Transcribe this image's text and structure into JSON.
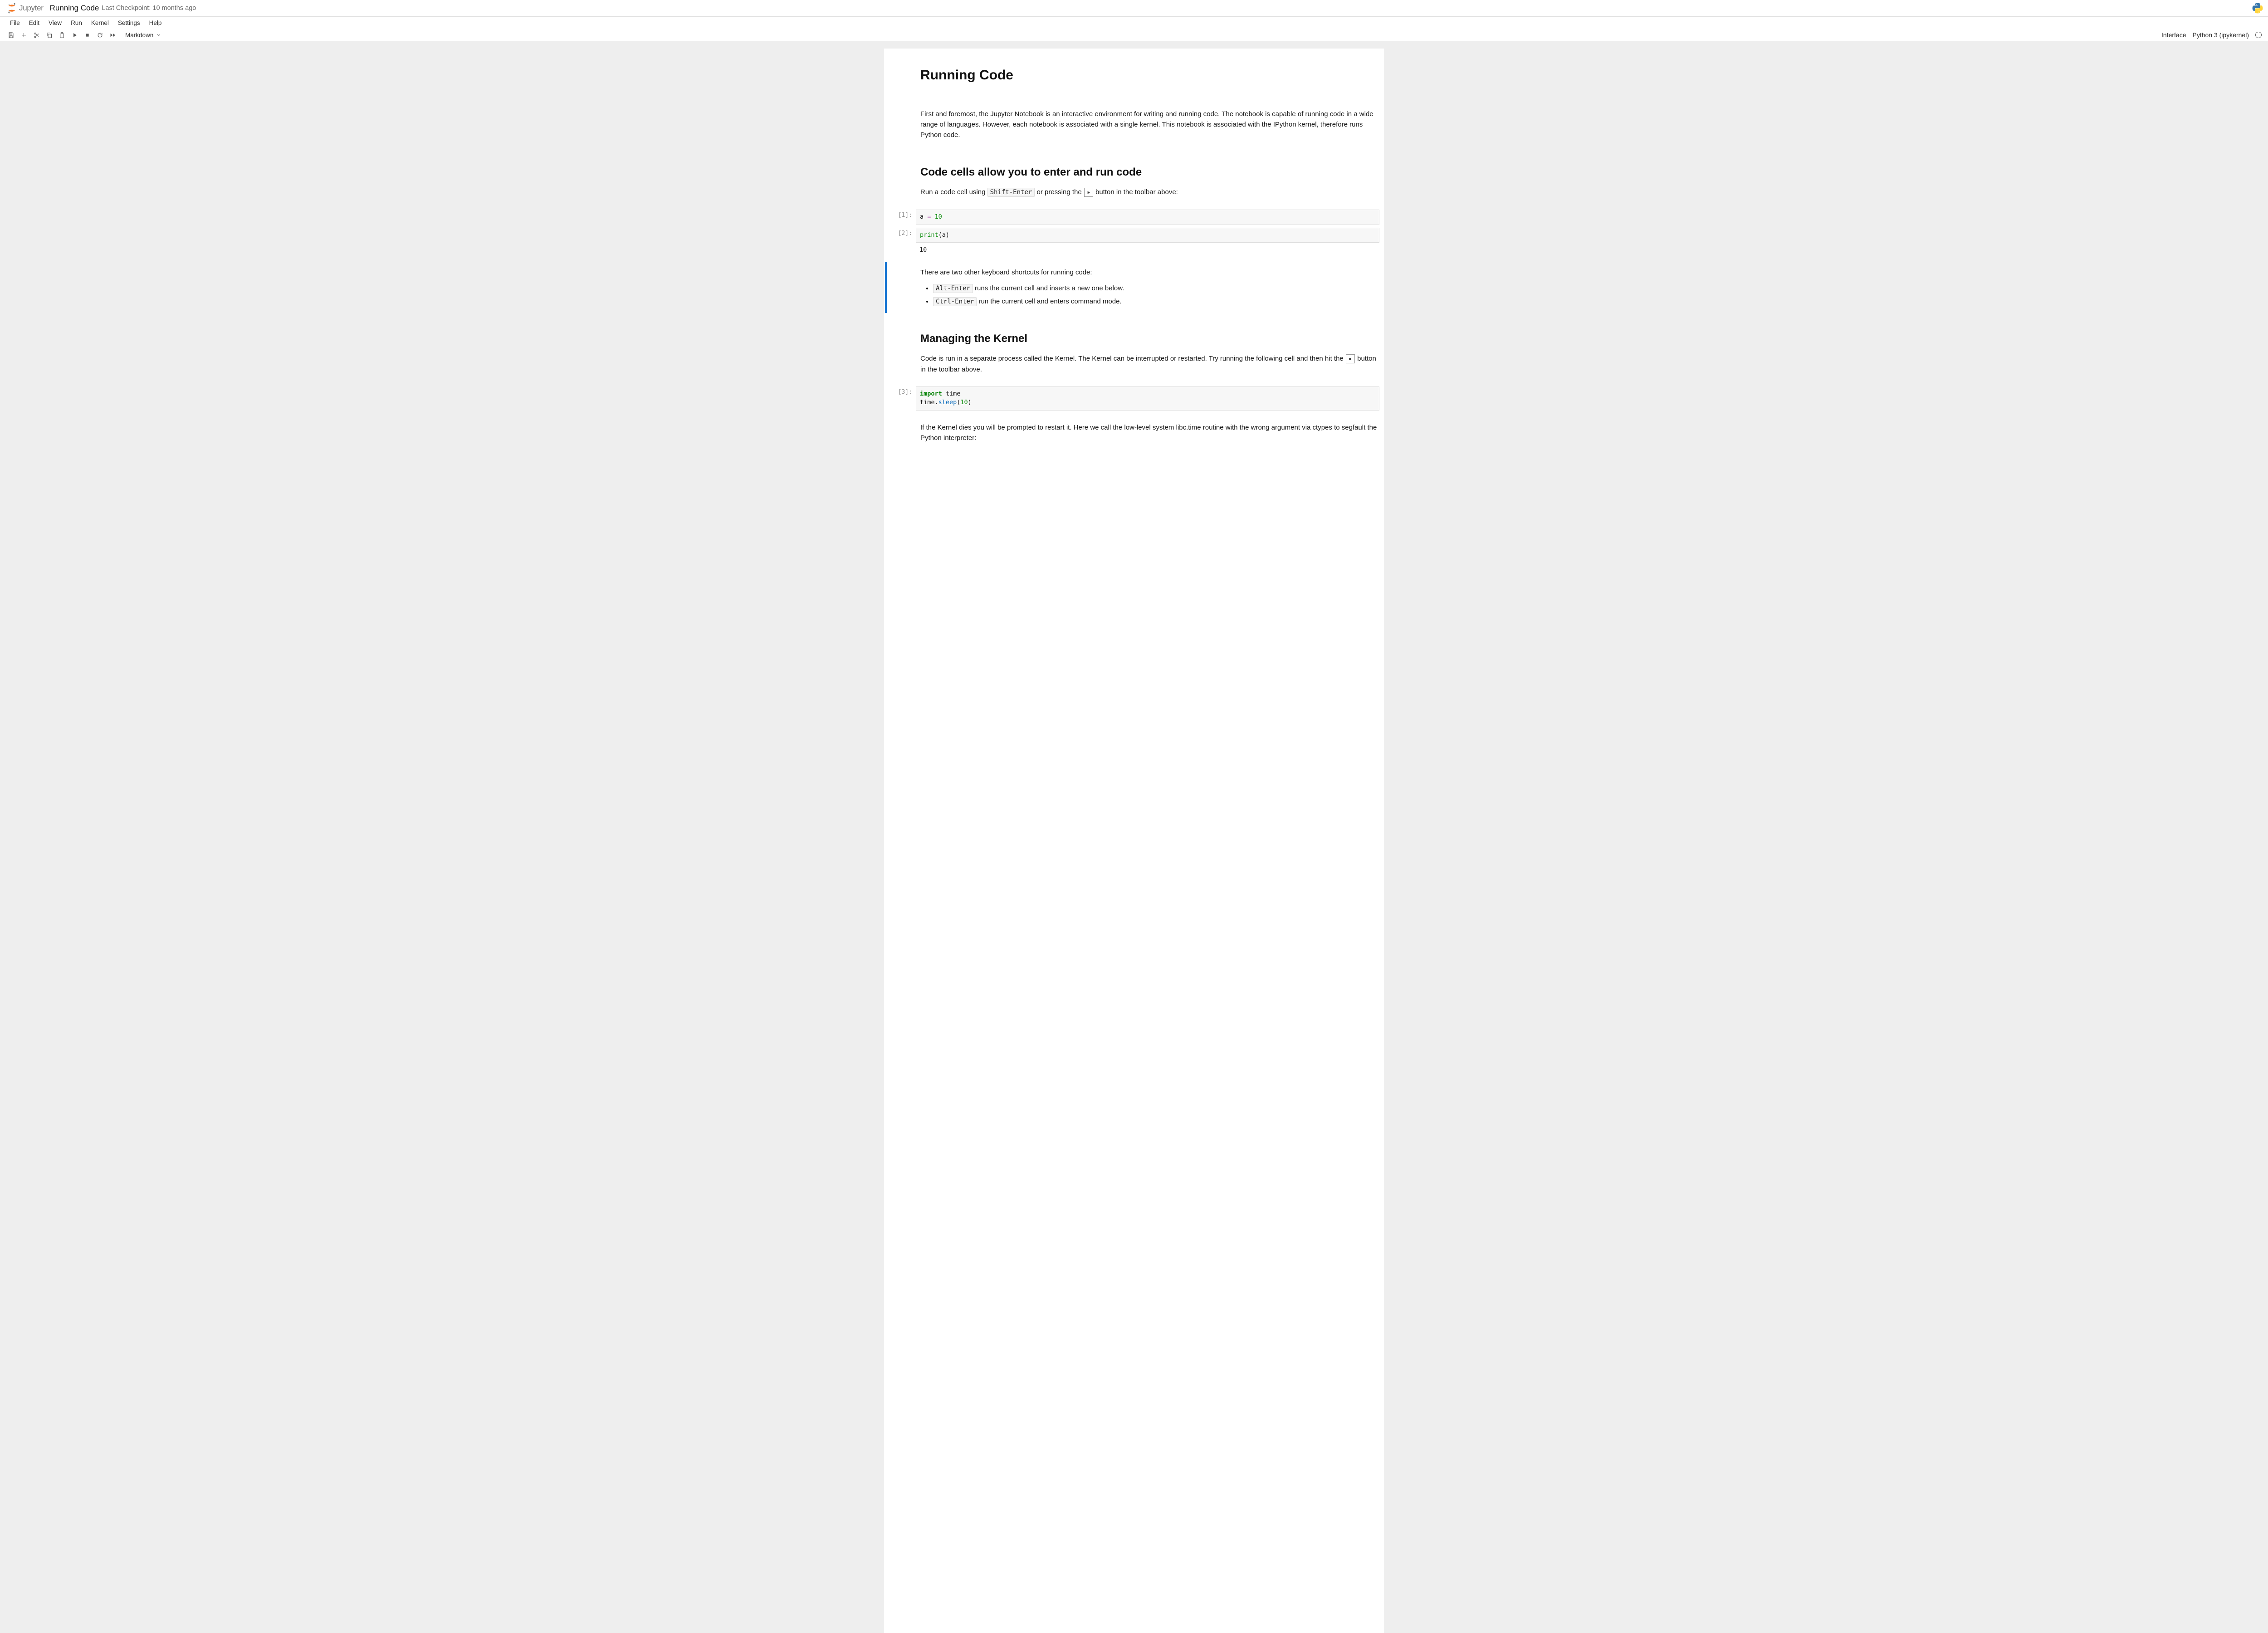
{
  "header": {
    "logo_text": "Jupyter",
    "title": "Running Code",
    "checkpoint": "Last Checkpoint: 10 months ago"
  },
  "menubar": {
    "items": [
      "File",
      "Edit",
      "View",
      "Run",
      "Kernel",
      "Settings",
      "Help"
    ]
  },
  "toolbar": {
    "cell_type": "Markdown",
    "interface": "Interface",
    "kernel": "Python 3 (ipykernel)"
  },
  "cells": {
    "h1": "Running Code",
    "intro_p": "First and foremost, the Jupyter Notebook is an interactive environment for writing and running code. The notebook is capable of running code in a wide range of languages. However, each notebook is associated with a single kernel. This notebook is associated with the IPython kernel, therefore runs Python code.",
    "h2a": "Code cells allow you to enter and run code",
    "run_instr_a": "Run a code cell using ",
    "run_kbd": "Shift-Enter",
    "run_instr_b": " or pressing the ",
    "run_instr_c": " button in the toolbar above:",
    "cell1_prompt": "[1]:",
    "cell1_code": "a = 10",
    "cell2_prompt": "[2]:",
    "cell2_code": "print(a)",
    "cell2_output": "10",
    "shortcuts_intro": "There are two other keyboard shortcuts for running code:",
    "sc1_kbd": "Alt-Enter",
    "sc1_txt": " runs the current cell and inserts a new one below.",
    "sc2_kbd": "Ctrl-Enter",
    "sc2_txt": " run the current cell and enters command mode.",
    "h2b": "Managing the Kernel",
    "manage_p_a": "Code is run in a separate process called the Kernel. The Kernel can be interrupted or restarted. Try running the following cell and then hit the ",
    "manage_p_b": " button in the toolbar above.",
    "cell3_prompt": "[3]:",
    "cell3_code_line1": "import time",
    "cell3_code_line2": "time.sleep(10)",
    "segfault_p": "If the Kernel dies you will be prompted to restart it. Here we call the low-level system libc.time routine with the wrong argument via ctypes to segfault the Python interpreter:"
  }
}
